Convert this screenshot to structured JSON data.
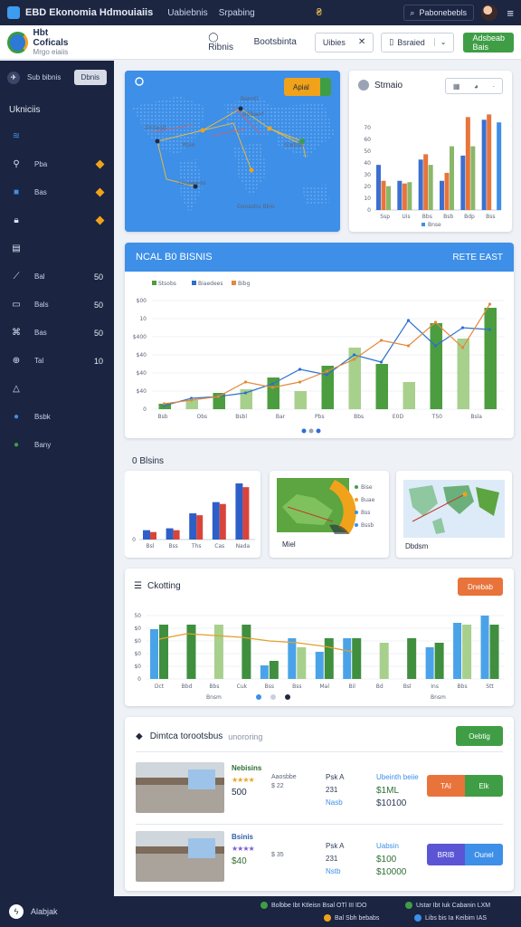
{
  "topbar": {
    "title": "EBD Ekonomia Hdmouiaiis",
    "links": [
      "Uabiebnis",
      "Srpabing"
    ],
    "search": "Pabonebebls"
  },
  "header": {
    "brand": "Hbt Coficals",
    "brand_sub": "Mrgo eiaiis",
    "links": [
      "Ribnis",
      "Bootsbinta"
    ],
    "field1": "Uibies",
    "field2": "Bsraied",
    "button": "Adsbeab Bais"
  },
  "sidebar": {
    "top_label": "Sub bibnis",
    "top_button": "Dbnis",
    "heading": "Ukniciis",
    "items": [
      {
        "label": "",
        "value": "",
        "diamond": false,
        "icon": "wifi-icon"
      },
      {
        "label": "Pba",
        "value": "",
        "diamond": true,
        "icon": "location-icon"
      },
      {
        "label": "Bas",
        "value": "",
        "diamond": true,
        "icon": "square-icon"
      },
      {
        "label": "",
        "value": "",
        "diamond": true,
        "icon": "lock-icon"
      },
      {
        "label": "",
        "value": "",
        "diamond": false,
        "icon": "document-icon"
      },
      {
        "label": "Bal",
        "value": "50",
        "diamond": false,
        "icon": "chart-icon"
      },
      {
        "label": "Bals",
        "value": "50",
        "diamond": false,
        "icon": "monitor-icon"
      },
      {
        "label": "Bas",
        "value": "50",
        "diamond": false,
        "icon": "network-icon"
      },
      {
        "label": "Tal",
        "value": "10",
        "diamond": false,
        "icon": "globe-icon"
      },
      {
        "label": "",
        "value": "",
        "diamond": false,
        "icon": "triangle-icon"
      },
      {
        "label": "Bsbk",
        "value": "",
        "diamond": false,
        "icon": "info-icon"
      },
      {
        "label": "Bany",
        "value": "",
        "diamond": false,
        "icon": "green-dot-icon"
      }
    ]
  },
  "map_card": {
    "button": "Apial",
    "labels": [
      "Dinteolt",
      "Baonti",
      "Gdlbanf",
      "Siwbbu",
      "Ghuwarss",
      "Rbio",
      "Gonasbu\nBbio"
    ]
  },
  "summary_card": {
    "title": "Stmaio"
  },
  "main_chart": {
    "title": "NCAL B0 BISNIS",
    "right": "RETE EAST",
    "legend": [
      "Stsobs",
      "Biaedees",
      "Bibg"
    ]
  },
  "section2": {
    "title": "0 Blsins",
    "donut_legend": [
      "Bise",
      "Buae",
      "Bss",
      "Bssb"
    ],
    "donut_caption": "Miel",
    "map_caption": "Dbdsm"
  },
  "section3": {
    "title": "Ckotting",
    "button": "Dnebab",
    "xcaption": "Bnsm"
  },
  "listings": {
    "title": "Dimtca torootsbus",
    "subtitle": "unororing",
    "button": "Oebtig",
    "rows": [
      {
        "name": "Nebisins",
        "tag": "Aaosbbe",
        "rating_num": "$ 22",
        "price": "500",
        "c1": "Psk A",
        "c2": "231",
        "c3": "Nasb",
        "d1": "Ubeinth beiie",
        "d2": "$1ML",
        "d3": "$10100",
        "b1": "TAI",
        "b2": "Elk"
      },
      {
        "name": "Bsinis",
        "tag": "",
        "rating_num": "$ 35",
        "price": "$40",
        "c1": "Psk A",
        "c2": "231",
        "c3": "Nstb",
        "d1": "Uabsin",
        "d2": "$100",
        "d3": "$10000",
        "b1": "BRIB",
        "b2": "Ounel"
      }
    ]
  },
  "footer": {
    "brand": "Alabjak",
    "meta": [
      "Bolbbe Ibt Ktleisn Bsal OTl III IDO",
      "Ustar Ibt Iuk Cabanin LXM",
      "Bal Sbh bebabs",
      "Libs bis Ia Keibim IAS"
    ]
  },
  "chart_data": [
    {
      "type": "bar",
      "title": "Stmaio",
      "categories": [
        "Ssp",
        "Uis",
        "Bbs",
        "Bsb",
        "Bdp",
        "Bss"
      ],
      "series": [
        {
          "name": "s1",
          "values": [
            34,
            22,
            38,
            22,
            41,
            68
          ]
        },
        {
          "name": "s2",
          "values": [
            22,
            20,
            42,
            28,
            70,
            72
          ]
        },
        {
          "name": "s3",
          "values": [
            18,
            21,
            34,
            48,
            48,
            0
          ]
        },
        {
          "name": "s4",
          "values": [
            0,
            0,
            0,
            0,
            0,
            66
          ]
        }
      ],
      "legend": [
        "Bnse"
      ],
      "yticks": [
        0,
        10,
        20,
        30,
        40,
        50,
        60,
        70,
        100
      ]
    },
    {
      "type": "bar",
      "title": "NCAL B0 BISNIS",
      "categories": [
        "Bsb",
        "Obs",
        "Bsbl",
        "Bar",
        "Pbs",
        "Bbs",
        "E0D",
        "T50",
        "Bsla"
      ],
      "series": [
        {
          "name": "Stsobs",
          "values": [
            6,
            10,
            18,
            22,
            35,
            20,
            48,
            68,
            50,
            30,
            95,
            78,
            112
          ]
        },
        {
          "name": "Biaedees",
          "values": [
            4,
            12,
            14,
            18,
            28,
            44,
            38,
            60,
            52,
            98,
            70,
            90,
            88
          ]
        },
        {
          "name": "Bibg",
          "values": [
            6,
            10,
            14,
            30,
            24,
            30,
            42,
            55,
            76,
            70,
            96,
            68,
            116
          ]
        }
      ],
      "yticks": [
        "0",
        "$40",
        "$40",
        "$40",
        "$400",
        "10",
        "$00"
      ]
    },
    {
      "type": "bar",
      "title": "0 Blsins",
      "categories": [
        "Bsl",
        "Bss",
        "Ths",
        "Cas",
        "Nada"
      ],
      "series": [
        {
          "name": "a",
          "values": [
            10,
            12,
            28,
            40,
            60
          ]
        },
        {
          "name": "b",
          "values": [
            8,
            10,
            26,
            38,
            56
          ]
        }
      ]
    },
    {
      "type": "bar",
      "title": "Ckotting",
      "categories": [
        "Dct",
        "Bbd",
        "Bbs",
        "Cuk",
        "Bss",
        "Bss",
        "Mal",
        "Bil",
        "Bd",
        "Bsl",
        "Ins",
        "Bbs",
        "Stt"
      ],
      "series": [
        {
          "name": "green",
          "values": [
            60,
            60,
            60,
            60,
            20,
            35,
            45,
            45,
            40,
            45,
            40,
            60,
            60
          ]
        },
        {
          "name": "blue",
          "values": [
            55,
            0,
            0,
            0,
            15,
            45,
            30,
            45,
            0,
            0,
            35,
            62,
            70
          ]
        },
        {
          "name": "line",
          "values": [
            44,
            50,
            48,
            46,
            42,
            40,
            36,
            30,
            0,
            0,
            0,
            0,
            0
          ]
        }
      ],
      "yticks": [
        "0",
        "$0",
        "$0",
        "$0",
        "$0",
        "50"
      ]
    }
  ]
}
